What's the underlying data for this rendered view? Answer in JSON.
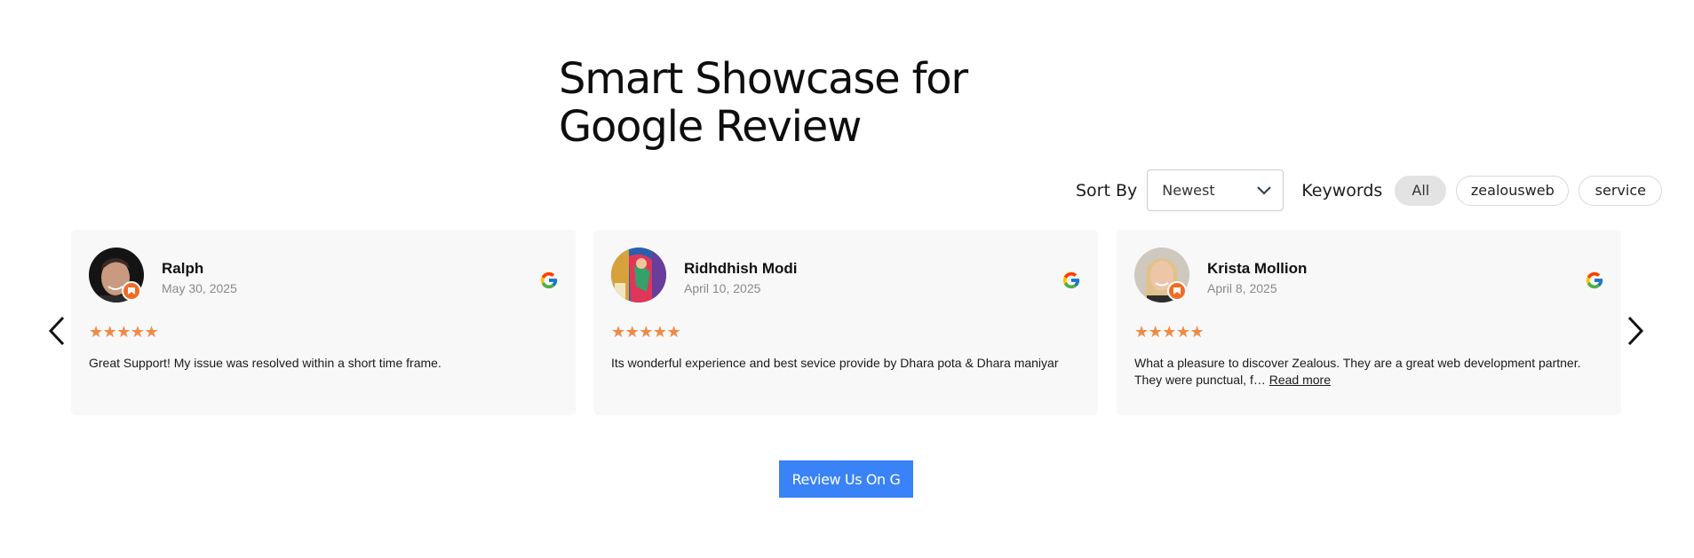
{
  "title": {
    "line1": "Smart Showcase for",
    "line2": "Google Review"
  },
  "sort": {
    "label": "Sort By",
    "value": "Newest"
  },
  "keywords": {
    "label": "Keywords",
    "chips": [
      {
        "label": "All",
        "active": true
      },
      {
        "label": "zealousweb",
        "active": false
      },
      {
        "label": "service",
        "active": false
      }
    ]
  },
  "reviews": [
    {
      "name": "Ralph",
      "date": "May 30, 2025",
      "stars": "★★★★★",
      "rating": 5,
      "text": "Great Support! My issue was resolved within a short time frame.",
      "read_more": ""
    },
    {
      "name": "Ridhdhish Modi",
      "date": "April 10, 2025",
      "stars": "★★★★★",
      "rating": 5,
      "text": "Its wonderful experience and best sevice provide by Dhara pota & Dhara maniyar",
      "read_more": ""
    },
    {
      "name": "Krista Mollion",
      "date": "April 8, 2025",
      "stars": "★★★★★",
      "rating": 5,
      "text": "What a pleasure to discover Zealous. They are a great web development partner. They were punctual, f…",
      "read_more": "Read more"
    }
  ],
  "cta": {
    "label": "Review Us On G"
  },
  "icons": {
    "prev": "chevron-left-icon",
    "next": "chevron-right-icon",
    "source": "google-icon",
    "sort": "chevron-down-icon",
    "badge": "local-guide-badge-icon"
  },
  "colors": {
    "accent": "#3a82f7",
    "star": "#ef8a45",
    "card_bg": "#f8f8f8",
    "chip_active": "#e3e3e3"
  }
}
